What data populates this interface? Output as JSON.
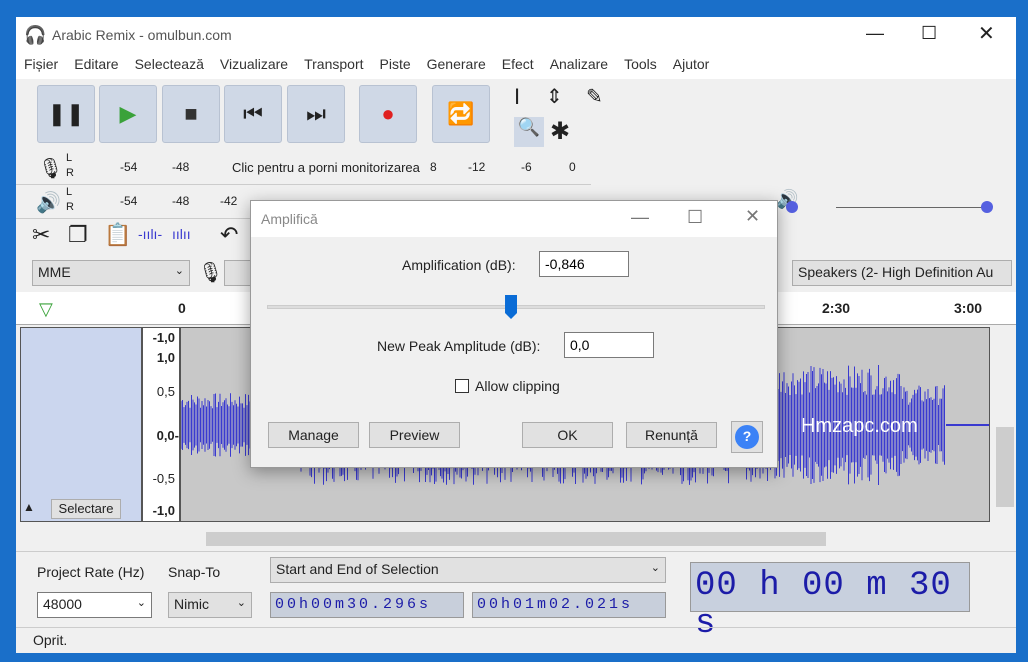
{
  "window": {
    "title": "Arabic Remix - omulbun.com"
  },
  "menu": [
    "Fișier",
    "Editare",
    "Selectează",
    "Vizualizare",
    "Transport",
    "Piste",
    "Generare",
    "Efect",
    "Analizare",
    "Tools",
    "Ajutor"
  ],
  "meters": {
    "record_hint": "Clic pentru a porni monitorizarea",
    "record_ticks": [
      "-54",
      "-48",
      "8",
      "-12",
      "-6",
      "0"
    ],
    "play_ticks": [
      "-54",
      "-48",
      "-42"
    ],
    "L": "L",
    "R": "R",
    "minus": "-",
    "plus": "+"
  },
  "device": {
    "host": "MME",
    "output": "Speakers (2- High Definition Au"
  },
  "ruler": [
    "0",
    "2:30",
    "3:00"
  ],
  "track": {
    "scale": [
      "-1,0",
      "1,0",
      "0,5",
      "0,0-",
      "-0,5",
      "-1,0"
    ],
    "select_label": "Selectare",
    "watermark": "Hmzapc.com",
    "wave_color": "#3a3ad0"
  },
  "selection_bar": {
    "rate_label": "Project Rate (Hz)",
    "snap_label": "Snap-To",
    "rate": "48000",
    "snap": "Nimic",
    "mode": "Start and End of Selection",
    "start": "00h00m30.296s",
    "end": "00h01m02.021s",
    "big_time": "00 h 00 m 30 s"
  },
  "status": "Oprit.",
  "dialog": {
    "title": "Amplifică",
    "amp_label": "Amplification (dB):",
    "amp_value": "-0,846",
    "slider_fraction": 0.49,
    "peak_label": "New Peak Amplitude (dB):",
    "peak_value": "0,0",
    "clip_label": "Allow clipping",
    "clip_checked": false,
    "manage": "Manage",
    "preview": "Preview",
    "ok": "OK",
    "cancel": "Renunță",
    "help": "?"
  }
}
